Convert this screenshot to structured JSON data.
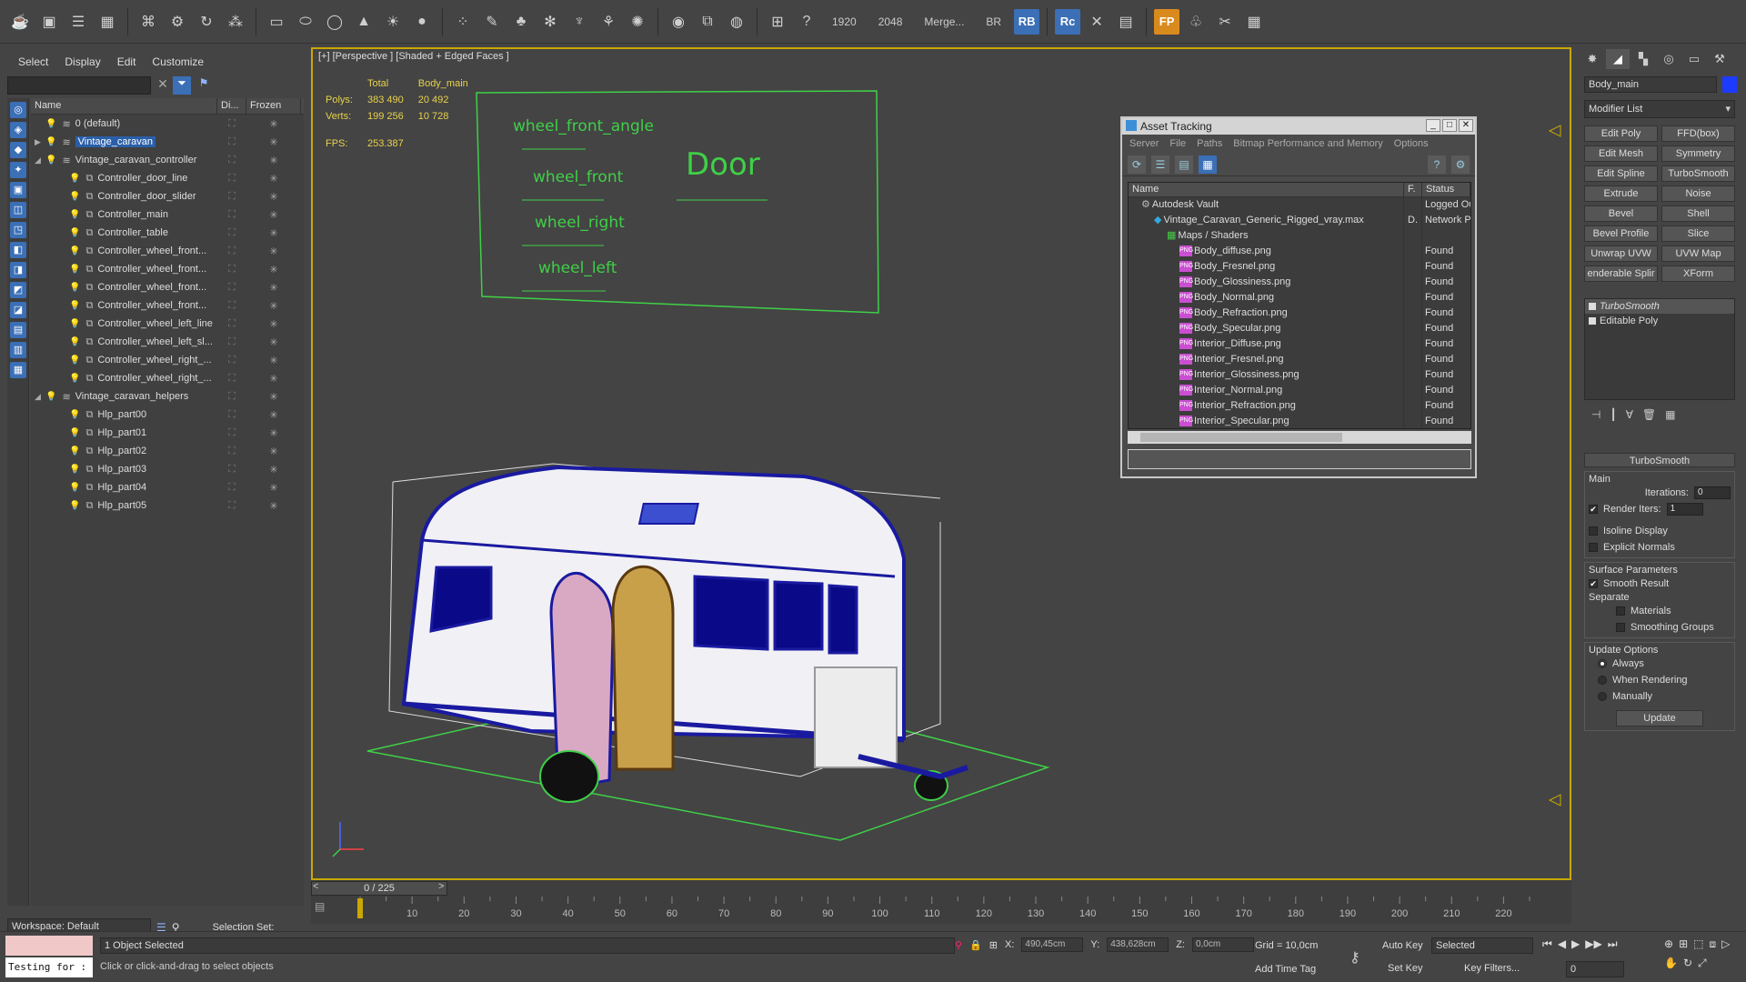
{
  "toolbar": {
    "res_width": "1920",
    "res_height": "2048",
    "merge": "Merge...",
    "br": "BR",
    "rb": "RB",
    "rc": "Rc",
    "fp": "FP"
  },
  "explorer": {
    "menu": [
      "Select",
      "Display",
      "Edit",
      "Customize"
    ],
    "columns": {
      "name": "Name",
      "display": "Di...",
      "frozen": "Frozen"
    },
    "rows": [
      {
        "label": "0 (default)",
        "indent": 1,
        "type": "layer",
        "twist": ""
      },
      {
        "label": "Vintage_caravan",
        "indent": 1,
        "type": "layer",
        "twist": "▶",
        "selected": true
      },
      {
        "label": "Vintage_caravan_controller",
        "indent": 1,
        "type": "layer",
        "twist": "◢"
      },
      {
        "label": "Controller_door_line",
        "indent": 2,
        "type": "obj",
        "twist": ""
      },
      {
        "label": "Controller_door_slider",
        "indent": 2,
        "type": "obj",
        "twist": ""
      },
      {
        "label": "Controller_main",
        "indent": 2,
        "type": "obj",
        "twist": ""
      },
      {
        "label": "Controller_table",
        "indent": 2,
        "type": "obj",
        "twist": ""
      },
      {
        "label": "Controller_wheel_front...",
        "indent": 2,
        "type": "obj",
        "twist": ""
      },
      {
        "label": "Controller_wheel_front...",
        "indent": 2,
        "type": "obj",
        "twist": ""
      },
      {
        "label": "Controller_wheel_front...",
        "indent": 2,
        "type": "obj",
        "twist": ""
      },
      {
        "label": "Controller_wheel_front...",
        "indent": 2,
        "type": "obj",
        "twist": ""
      },
      {
        "label": "Controller_wheel_left_line",
        "indent": 2,
        "type": "obj",
        "twist": ""
      },
      {
        "label": "Controller_wheel_left_sl...",
        "indent": 2,
        "type": "obj",
        "twist": ""
      },
      {
        "label": "Controller_wheel_right_...",
        "indent": 2,
        "type": "obj",
        "twist": ""
      },
      {
        "label": "Controller_wheel_right_...",
        "indent": 2,
        "type": "obj",
        "twist": ""
      },
      {
        "label": "Vintage_caravan_helpers",
        "indent": 1,
        "type": "layer",
        "twist": "◢"
      },
      {
        "label": "Hlp_part00",
        "indent": 2,
        "type": "obj",
        "twist": ""
      },
      {
        "label": "Hlp_part01",
        "indent": 2,
        "type": "obj",
        "twist": ""
      },
      {
        "label": "Hlp_part02",
        "indent": 2,
        "type": "obj",
        "twist": ""
      },
      {
        "label": "Hlp_part03",
        "indent": 2,
        "type": "obj",
        "twist": ""
      },
      {
        "label": "Hlp_part04",
        "indent": 2,
        "type": "obj",
        "twist": ""
      },
      {
        "label": "Hlp_part05",
        "indent": 2,
        "type": "obj",
        "twist": ""
      }
    ],
    "workspace": "Workspace: Default",
    "selection_set": "Selection Set:"
  },
  "viewport": {
    "label": "[+] [Perspective ] [Shaded + Edged Faces ]",
    "stats": {
      "col_total": "Total",
      "col_obj": "Body_main",
      "polys_label": "Polys:",
      "polys_total": "383 490",
      "polys_obj": "20 492",
      "verts_label": "Verts:",
      "verts_total": "199 256",
      "verts_obj": "10 728",
      "fps_label": "FPS:",
      "fps": "253.387"
    },
    "panel": {
      "labels": [
        "wheel_front_angle",
        "wheel_front",
        "wheel_right",
        "wheel_left"
      ],
      "door": "Door"
    }
  },
  "asset": {
    "title": "Asset Tracking",
    "menu": [
      "Server",
      "File",
      "Paths",
      "Bitmap Performance and Memory",
      "Options"
    ],
    "columns": {
      "name": "Name",
      "f": "F.",
      "status": "Status"
    },
    "rows": [
      {
        "name": "Autodesk Vault",
        "indent": 0,
        "f": "",
        "status": "Logged Ou",
        "kind": "vault"
      },
      {
        "name": "Vintage_Caravan_Generic_Rigged_vray.max",
        "indent": 1,
        "f": "D.",
        "status": "Network Pa",
        "kind": "max"
      },
      {
        "name": "Maps / Shaders",
        "indent": 2,
        "f": "",
        "status": "",
        "kind": "folder"
      },
      {
        "name": "Body_diffuse.png",
        "indent": 3,
        "f": "",
        "status": "Found",
        "kind": "png"
      },
      {
        "name": "Body_Fresnel.png",
        "indent": 3,
        "f": "",
        "status": "Found",
        "kind": "png"
      },
      {
        "name": "Body_Glossiness.png",
        "indent": 3,
        "f": "",
        "status": "Found",
        "kind": "png"
      },
      {
        "name": "Body_Normal.png",
        "indent": 3,
        "f": "",
        "status": "Found",
        "kind": "png"
      },
      {
        "name": "Body_Refraction.png",
        "indent": 3,
        "f": "",
        "status": "Found",
        "kind": "png"
      },
      {
        "name": "Body_Specular.png",
        "indent": 3,
        "f": "",
        "status": "Found",
        "kind": "png"
      },
      {
        "name": "Interior_Diffuse.png",
        "indent": 3,
        "f": "",
        "status": "Found",
        "kind": "png"
      },
      {
        "name": "Interior_Fresnel.png",
        "indent": 3,
        "f": "",
        "status": "Found",
        "kind": "png"
      },
      {
        "name": "Interior_Glossiness.png",
        "indent": 3,
        "f": "",
        "status": "Found",
        "kind": "png"
      },
      {
        "name": "Interior_Normal.png",
        "indent": 3,
        "f": "",
        "status": "Found",
        "kind": "png"
      },
      {
        "name": "Interior_Refraction.png",
        "indent": 3,
        "f": "",
        "status": "Found",
        "kind": "png"
      },
      {
        "name": "Interior_Specular.png",
        "indent": 3,
        "f": "",
        "status": "Found",
        "kind": "png"
      }
    ],
    "png_tag": "PNG"
  },
  "command": {
    "object_name": "Body_main",
    "object_color": "#1d3bff",
    "modifier_list": "Modifier List",
    "modifier_buttons": [
      "Edit Poly",
      "FFD(box)",
      "Edit Mesh",
      "Symmetry",
      "Edit Spline",
      "TurboSmooth",
      "Extrude",
      "Noise",
      "Bevel",
      "Shell",
      "Bevel Profile",
      "Slice",
      "Unwrap UVW",
      "UVW Map",
      "enderable Splir",
      "XForm"
    ],
    "stack": [
      "TurboSmooth",
      "Editable Poly"
    ],
    "turbosmooth": {
      "title": "TurboSmooth",
      "main": "Main",
      "iterations_label": "Iterations:",
      "iterations": "0",
      "render_iters_label": "Render Iters:",
      "render_iters": "1",
      "isoline": "Isoline Display",
      "explicit": "Explicit Normals",
      "surface": "Surface Parameters",
      "smooth_result": "Smooth Result",
      "separate": "Separate",
      "materials": "Materials",
      "smoothing_groups": "Smoothing Groups",
      "update_options": "Update Options",
      "always": "Always",
      "when_rendering": "When Rendering",
      "manually": "Manually",
      "update": "Update"
    }
  },
  "timeline": {
    "slider": "0 / 225",
    "ticks": [
      "10",
      "20",
      "30",
      "40",
      "50",
      "60",
      "70",
      "80",
      "90",
      "100",
      "110",
      "120",
      "130",
      "140",
      "150",
      "160",
      "170",
      "180",
      "190",
      "200",
      "210",
      "220"
    ]
  },
  "status": {
    "maxscript": "Testing for :",
    "selected": "1 Object Selected",
    "prompt": "Click or click-and-drag to select objects",
    "x_label": "X:",
    "x": "490,45cm",
    "y_label": "Y:",
    "y": "438,628cm",
    "z_label": "Z:",
    "z": "0,0cm",
    "grid": "Grid = 10,0cm",
    "add_time_tag": "Add Time Tag",
    "auto_key": "Auto Key",
    "auto_key_sel": "Selected",
    "set_key": "Set Key",
    "key_filters": "Key Filters...",
    "frame": "0"
  }
}
